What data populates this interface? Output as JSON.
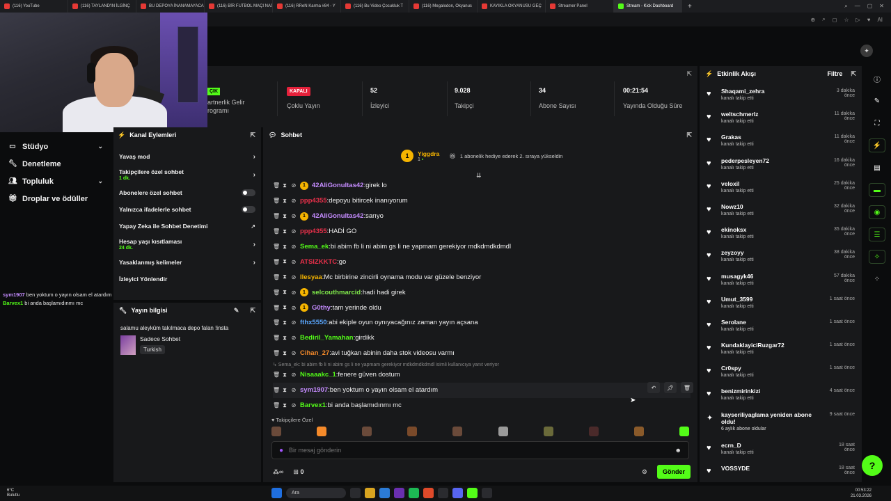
{
  "browser": {
    "tabs": [
      {
        "label": "(116) YouTube",
        "active": false
      },
      {
        "label": "(116) TAYLAND'IN İLGİNÇ",
        "active": false
      },
      {
        "label": "BU DEPOYA İNANAMAYACAKSIN",
        "active": false
      },
      {
        "label": "(116) BİR FUTBOL MAÇI NASIL",
        "active": false
      },
      {
        "label": "(116) RReN Karma #84 - Y",
        "active": false
      },
      {
        "label": "(116) Bu Video Çocukluk T",
        "active": false
      },
      {
        "label": "(116) Megalodon, Okyanus",
        "active": false
      },
      {
        "label": "KAYIKLA OKYANUSU GEÇ",
        "active": false
      },
      {
        "label": "Streamer Panel",
        "active": false
      },
      {
        "label": "Stream - Kick Dashboard",
        "active": true
      }
    ],
    "new_tab": "+"
  },
  "left_nav": [
    {
      "label": "Stüdyo",
      "icon": "studio-icon",
      "chevron": true
    },
    {
      "label": "Denetleme",
      "icon": "wrench-icon",
      "chevron": false
    },
    {
      "label": "Topluluk",
      "icon": "people-icon",
      "chevron": true
    },
    {
      "label": "Droplar ve ödüller",
      "icon": "gift-icon",
      "chevron": false
    }
  ],
  "overlay_chat": [
    {
      "user": "sym1907",
      "text": "ben yoktum o yayın olsam el atardım",
      "color": "#c58cff"
    },
    {
      "user": "Barvex1",
      "text": "bi anda başlamıdınmı mc",
      "color": "#53fc18"
    }
  ],
  "stats": {
    "partner": {
      "badge": "ÇIK",
      "label": "artnerlik Gelir\nrogramı"
    },
    "multistream": {
      "badge": "KAPALI",
      "label": "Çoklu Yayın"
    },
    "viewers": {
      "value": "52",
      "label": "İzleyici"
    },
    "followers": {
      "value": "9.028",
      "label": "Takipçi"
    },
    "subscribers": {
      "value": "34",
      "label": "Abone Sayısı"
    },
    "uptime": {
      "value": "00:21:54",
      "label": "Yayında Olduğu Süre"
    }
  },
  "channel_actions": {
    "title": "Kanal Eylemleri",
    "items": [
      {
        "label": "Yavaş mod",
        "sub": "",
        "control": "chevron"
      },
      {
        "label": "Takipçilere özel sohbet",
        "sub": "1 dk.",
        "control": "chevron"
      },
      {
        "label": "Abonelere özel sohbet",
        "sub": "",
        "control": "toggle"
      },
      {
        "label": "Yalnızca ifadelerle sohbet",
        "sub": "",
        "control": "toggle"
      },
      {
        "label": "Yapay Zeka ile Sohbet Denetimi",
        "sub": "",
        "control": "external"
      },
      {
        "label": "Hesap yaşı kısıtlaması",
        "sub": "24 dk.",
        "control": "chevron"
      },
      {
        "label": "Yasaklanmış kelimeler",
        "sub": "",
        "control": "chevron"
      },
      {
        "label": "İzleyici Yönlendir",
        "sub": "",
        "control": "none"
      }
    ]
  },
  "stream_info": {
    "title": "Yayın bilgisi",
    "stream_title": "salamu aleykûm takılmaca depo falan !insta",
    "category": "Sadece Sohbet",
    "language": "Turkish"
  },
  "chat": {
    "title": "Sohbet",
    "pinned": {
      "coin": "1",
      "user": "Yiggdra",
      "count": "1",
      "message": "1 abonelik hediye ederek 2. sıraya yükseldin"
    },
    "messages": [
      {
        "user": "42AliGonultas42",
        "color": "#c58cff",
        "text": "girek lo",
        "badge": "1"
      },
      {
        "user": "ppp4355",
        "color": "#e8304a",
        "text": "depoyu bitircek inanıyorum",
        "badge": ""
      },
      {
        "user": "42AliGonultas42",
        "color": "#c58cff",
        "text": "sarıyo",
        "badge": "1"
      },
      {
        "user": "ppp4355",
        "color": "#e8304a",
        "text": "HADİ GO",
        "badge": ""
      },
      {
        "user": "Sema_ek",
        "color": "#53fc18",
        "text": "bi abim fb li ni abim gs li ne yapmam gerekiyor mdkdmdkdmdl",
        "badge": ""
      },
      {
        "user": "ATSIZKKTC",
        "color": "#e8304a",
        "text": "go",
        "badge": ""
      },
      {
        "user": "Ilesyaa",
        "color": "#f5b400",
        "text": "Mc birbirine zincirli oynama modu var güzele benziyor",
        "badge": ""
      },
      {
        "user": "selcouthmarcid",
        "color": "#7fe84a",
        "text": "hadi hadi girek",
        "badge": "1"
      },
      {
        "user": "G0thy",
        "color": "#c58cff",
        "text": "tam yerinde oldu",
        "badge": "1"
      },
      {
        "user": "fthx5550",
        "color": "#5aa7ff",
        "text": "abi ekiple oyun oynıyacağınız zaman yayın açsana",
        "badge": ""
      },
      {
        "user": "Bediril_Yamahan",
        "color": "#53fc18",
        "text": "girdikk",
        "badge": ""
      },
      {
        "user": "Cihan_27",
        "color": "#f58a2a",
        "text": "avi tuğkan abinin daha stok videosu varmı",
        "badge": ""
      }
    ],
    "reply_note": "↳ Sema_ek: bi abim fb li ni abim gs li ne yapmam gerekiyor mdkdmdkdmdl isimli kullanıcıya yanıt veriyor",
    "messages2": [
      {
        "user": "Nisaaakc_1",
        "color": "#53fc18",
        "text": "fenere güven dostum"
      },
      {
        "user": "sym1907",
        "color": "#c58cff",
        "text": "ben yoktum o yayın olsam el atardım"
      },
      {
        "user": "Barvex1",
        "color": "#53fc18",
        "text": "bi anda başlamıdınmı mc"
      }
    ],
    "emote_label": "♥ Takipçilere Özel",
    "input_placeholder": "Bir mesaj gönderin",
    "footer_count": "0",
    "send_label": "Gönder"
  },
  "activity": {
    "title": "Etkinlik Akışı",
    "filter": "Filtre",
    "items": [
      {
        "name": "Shaqami_zehra",
        "sub": "kanalı takip etti",
        "time": "3 dakika önce"
      },
      {
        "name": "weltschmerlz",
        "sub": "kanalı takip etti",
        "time": "11 dakika önce"
      },
      {
        "name": "Grakas",
        "sub": "kanalı takip etti",
        "time": "11 dakika önce"
      },
      {
        "name": "pederpesleyen72",
        "sub": "kanalı takip etti",
        "time": "16 dakika önce"
      },
      {
        "name": "veloxil",
        "sub": "kanalı takip etti",
        "time": "25 dakika önce"
      },
      {
        "name": "Nowz10",
        "sub": "kanalı takip etti",
        "time": "32 dakika önce"
      },
      {
        "name": "ekinoksx",
        "sub": "kanalı takip etti",
        "time": "35 dakika önce"
      },
      {
        "name": "zeyzoyy",
        "sub": "kanalı takip etti",
        "time": "38 dakika önce"
      },
      {
        "name": "musagyk46",
        "sub": "kanalı takip etti",
        "time": "57 dakika önce"
      },
      {
        "name": "Umut_3599",
        "sub": "kanalı takip etti",
        "time": "1 saat önce"
      },
      {
        "name": "Serolane",
        "sub": "kanalı takip etti",
        "time": "1 saat önce"
      },
      {
        "name": "KundaklayiciRuzgar72",
        "sub": "kanalı takip etti",
        "time": "1 saat önce"
      },
      {
        "name": "Cr0spy",
        "sub": "kanalı takip etti",
        "time": "1 saat önce"
      },
      {
        "name": "benizmirinkizi",
        "sub": "kanalı takip etti",
        "time": "4 saat önce"
      },
      {
        "name": "kayseriliyaglama yeniden abone oldu!",
        "sub": "6 aylık abone oldular",
        "time": "9 saat önce",
        "sub_event": true
      },
      {
        "name": "ecrn_D",
        "sub": "kanalı takip etti",
        "time": "18 saat önce"
      },
      {
        "name": "VOSSYDE",
        "sub": "",
        "time": "18 saat önce"
      }
    ]
  },
  "taskbar": {
    "weather_temp": "6°C",
    "weather_desc": "Bulutlu",
    "search": "Ara",
    "time": "00:53:22",
    "date": "21.03.2026"
  }
}
